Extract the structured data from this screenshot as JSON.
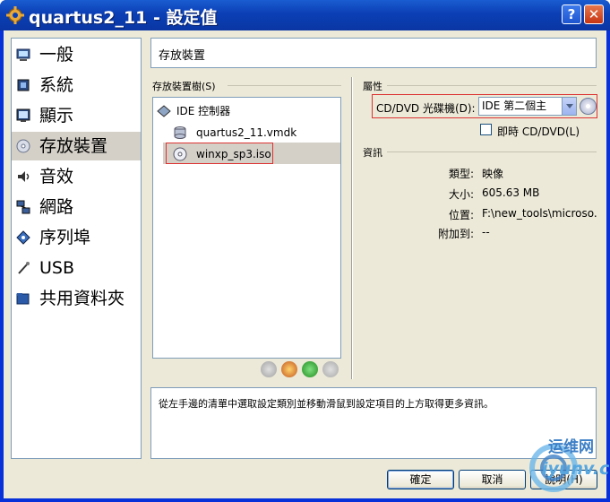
{
  "window": {
    "title": "quartus2_11 - 設定值",
    "help_label": "?",
    "close_label": "✕"
  },
  "sidebar": {
    "items": [
      {
        "label": "一般",
        "icon": "monitor-icon"
      },
      {
        "label": "系統",
        "icon": "chip-icon"
      },
      {
        "label": "顯示",
        "icon": "display-icon"
      },
      {
        "label": "存放裝置",
        "icon": "disc-icon",
        "selected": true
      },
      {
        "label": "音效",
        "icon": "speaker-icon"
      },
      {
        "label": "網路",
        "icon": "network-icon"
      },
      {
        "label": "序列埠",
        "icon": "serial-port-icon"
      },
      {
        "label": "USB",
        "icon": "usb-icon"
      },
      {
        "label": "共用資料夾",
        "icon": "folder-icon"
      }
    ]
  },
  "header": {
    "title": "存放裝置"
  },
  "storage_tree": {
    "group_label": "存放裝置樹(S)",
    "controller": "IDE 控制器",
    "disk": "quartus2_11.vmdk",
    "iso": "winxp_sp3.iso"
  },
  "attributes": {
    "section_title": "屬性",
    "cd_label": "CD/DVD 光碟機(D):",
    "cd_value": "IDE 第二個主",
    "live_cd_label": "即時 CD/DVD(L)"
  },
  "info": {
    "section_title": "資訊",
    "rows": [
      {
        "label": "類型:",
        "value": "映像"
      },
      {
        "label": "大小:",
        "value": "605.63 MB"
      },
      {
        "label": "位置:",
        "value": "F:\\new_tools\\microso..."
      },
      {
        "label": "附加到:",
        "value": "--"
      }
    ]
  },
  "description": "從左手邊的清單中選取設定類別並移動滑鼠到設定項目的上方取得更多資訊。",
  "buttons": {
    "ok": "確定",
    "cancel": "取消",
    "help": "說明(H)"
  },
  "watermark": {
    "line1": "运维网",
    "line2": "iyunv.com"
  },
  "colors": {
    "title_bar": "#0b3fb5",
    "highlight_box": "#dd3333",
    "dialog_bg": "#ece9d8"
  }
}
